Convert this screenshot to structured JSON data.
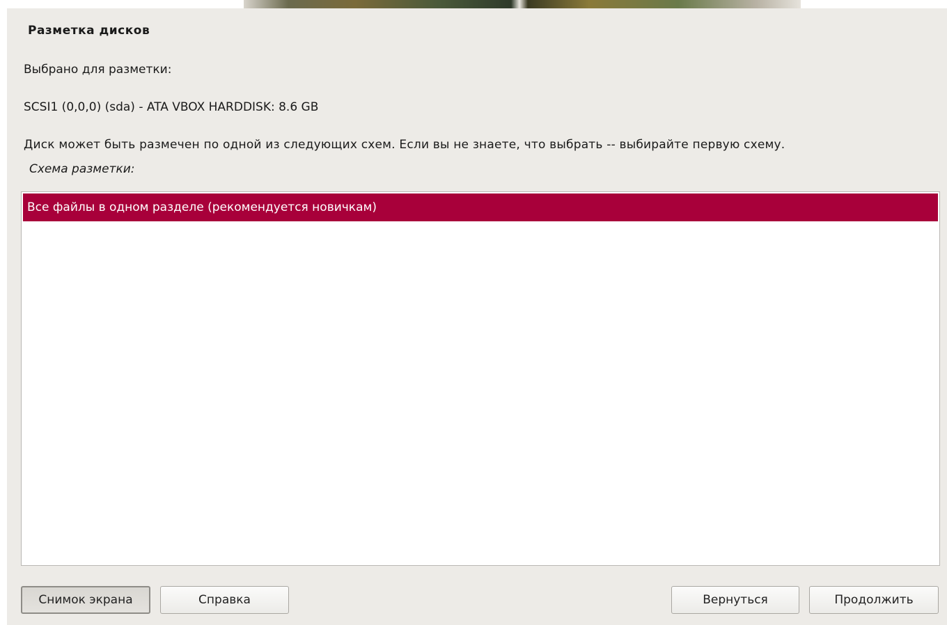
{
  "dialog": {
    "title": "Разметка дисков",
    "selected_label": "Выбрано для разметки:",
    "disk": "SCSI1 (0,0,0) (sda) - ATA VBOX HARDDISK: 8.6 GB",
    "description": "Диск может быть размечен по одной из следующих схем. Если вы не знаете, что выбрать -- выбирайте первую схему.",
    "scheme_label": "Схема разметки:"
  },
  "schemes": {
    "items": [
      {
        "label": "Все файлы в одном разделе (рекомендуется новичкам)",
        "selected": true
      }
    ]
  },
  "buttons": {
    "screenshot": "Снимок экрана",
    "help": "Справка",
    "back": "Вернуться",
    "continue": "Продолжить"
  },
  "colors": {
    "selection": "#a8003a",
    "panel": "#edebe7"
  }
}
